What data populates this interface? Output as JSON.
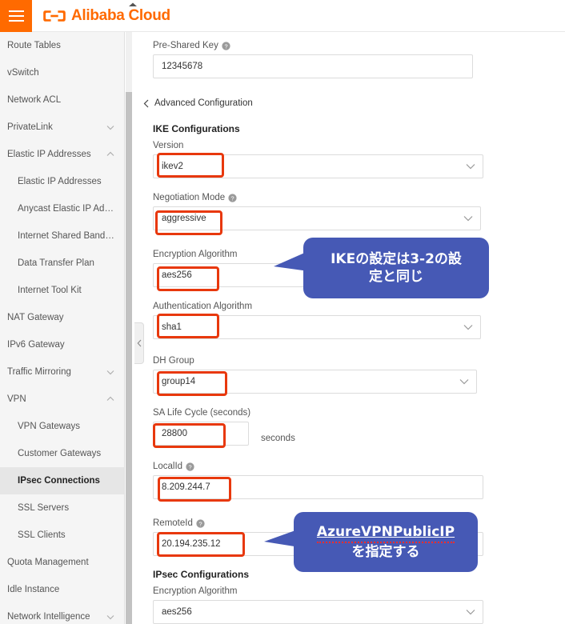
{
  "header": {
    "menu_icon": "hamburger-menu-icon",
    "logo_icon": "alibaba-cloud-logo-icon",
    "brand": "Alibaba Cloud",
    "brand_color": "#ff6a00"
  },
  "sidebar": {
    "scroll_up_icon": "scroll-up-arrow-icon",
    "items": [
      {
        "label": "Route Tables",
        "level": 0,
        "expander": "none",
        "selected": false
      },
      {
        "label": "vSwitch",
        "level": 0,
        "expander": "none",
        "selected": false
      },
      {
        "label": "Network ACL",
        "level": 0,
        "expander": "none",
        "selected": false
      },
      {
        "label": "PrivateLink",
        "level": 0,
        "expander": "collapsed",
        "selected": false
      },
      {
        "label": "Elastic IP Addresses",
        "level": 0,
        "expander": "expanded",
        "selected": false
      },
      {
        "label": "Elastic IP Addresses",
        "level": 1,
        "expander": "none",
        "selected": false
      },
      {
        "label": "Anycast Elastic IP Addresses",
        "level": 1,
        "expander": "none",
        "selected": false
      },
      {
        "label": "Internet Shared Bandwidth",
        "level": 1,
        "expander": "none",
        "selected": false
      },
      {
        "label": "Data Transfer Plan",
        "level": 1,
        "expander": "none",
        "selected": false
      },
      {
        "label": "Internet Tool Kit",
        "level": 1,
        "expander": "none",
        "selected": false
      },
      {
        "label": "NAT Gateway",
        "level": 0,
        "expander": "none",
        "selected": false
      },
      {
        "label": "IPv6 Gateway",
        "level": 0,
        "expander": "none",
        "selected": false
      },
      {
        "label": "Traffic Mirroring",
        "level": 0,
        "expander": "collapsed",
        "selected": false
      },
      {
        "label": "VPN",
        "level": 0,
        "expander": "expanded",
        "selected": false
      },
      {
        "label": "VPN Gateways",
        "level": 1,
        "expander": "none",
        "selected": false
      },
      {
        "label": "Customer Gateways",
        "level": 1,
        "expander": "none",
        "selected": false
      },
      {
        "label": "IPsec Connections",
        "level": 1,
        "expander": "none",
        "selected": true
      },
      {
        "label": "SSL Servers",
        "level": 1,
        "expander": "none",
        "selected": false
      },
      {
        "label": "SSL Clients",
        "level": 1,
        "expander": "none",
        "selected": false
      },
      {
        "label": "Quota Management",
        "level": 0,
        "expander": "none",
        "selected": false
      },
      {
        "label": "Idle Instance",
        "level": 0,
        "expander": "none",
        "selected": false
      },
      {
        "label": "Network Intelligence",
        "level": 0,
        "expander": "collapsed",
        "selected": false
      }
    ]
  },
  "collapse_handle": {
    "icon": "chevron-left-icon"
  },
  "form": {
    "pre_shared_key": {
      "label": "Pre-Shared Key",
      "value": "12345678",
      "help": "help-icon"
    },
    "advanced_configuration": {
      "label": "Advanced Configuration",
      "icon": "chevron-left-icon"
    },
    "ike_section": {
      "title": "IKE Configurations"
    },
    "ike_version": {
      "label": "Version",
      "value": "ikev2"
    },
    "ike_negotiation": {
      "label": "Negotiation Mode",
      "value": "aggressive",
      "help": "help-icon"
    },
    "ike_encryption": {
      "label": "Encryption Algorithm",
      "value": "aes256"
    },
    "ike_authentication": {
      "label": "Authentication Algorithm",
      "value": "sha1"
    },
    "ike_dh_group": {
      "label": "DH Group",
      "value": "group14"
    },
    "ike_sa_life": {
      "label": "SA Life Cycle (seconds)",
      "value": "28800",
      "unit": "seconds"
    },
    "local_id": {
      "label": "LocalId",
      "value": "8.209.244.7",
      "help": "help-icon"
    },
    "remote_id": {
      "label": "RemoteId",
      "value": "20.194.235.12",
      "help": "help-icon"
    },
    "ipsec_section": {
      "title": "IPsec Configurations"
    },
    "ipsec_encryption": {
      "label": "Encryption Algorithm",
      "value": "aes256"
    },
    "dropdown_icon": "chevron-down-icon"
  },
  "annotations": {
    "highlight_color": "#e8380d",
    "callout_color": "#4659b5",
    "callout_1": {
      "line1": "IKEの設定は3-2の設",
      "line2": "定と同じ"
    },
    "callout_2": {
      "line1": "AzureVPNPublicIP",
      "line2": "を指定する"
    }
  }
}
